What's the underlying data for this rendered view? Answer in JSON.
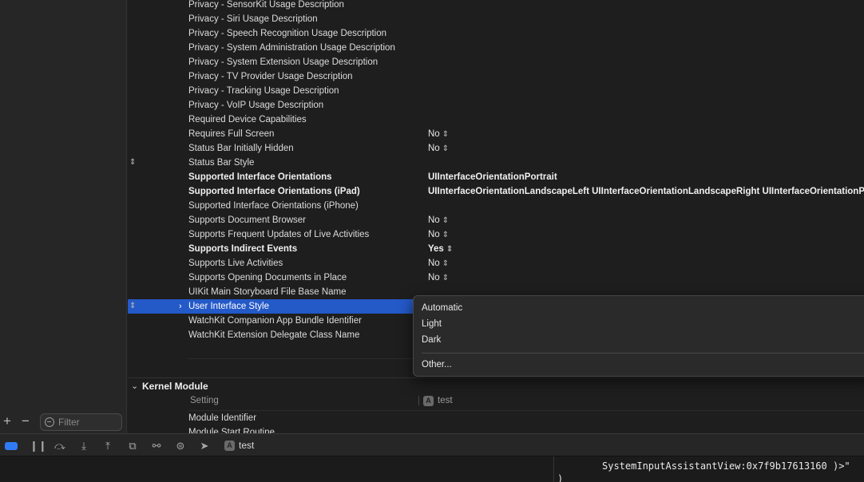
{
  "sidebar": {
    "add_symbol": "+",
    "remove_symbol": "−",
    "filter_placeholder": "Filter"
  },
  "rows": [
    {
      "key": "Privacy - SensorKit Usage Description",
      "value": "",
      "stepper": false
    },
    {
      "key": "Privacy - Siri Usage Description",
      "value": "",
      "stepper": false
    },
    {
      "key": "Privacy - Speech Recognition Usage Description",
      "value": "",
      "stepper": false
    },
    {
      "key": "Privacy - System Administration Usage Description",
      "value": "",
      "stepper": false
    },
    {
      "key": "Privacy - System Extension Usage Description",
      "value": "",
      "stepper": false
    },
    {
      "key": "Privacy - TV Provider Usage Description",
      "value": "",
      "stepper": false
    },
    {
      "key": "Privacy - Tracking Usage Description",
      "value": "",
      "stepper": false
    },
    {
      "key": "Privacy - VoIP Usage Description",
      "value": "",
      "stepper": false
    },
    {
      "key": "Required Device Capabilities",
      "value": "",
      "stepper": false
    },
    {
      "key": "Requires Full Screen",
      "value": "No",
      "stepper": true
    },
    {
      "key": "Status Bar Initially Hidden",
      "value": "No",
      "stepper": true
    },
    {
      "key": "Status Bar Style",
      "value": "",
      "stepper": false,
      "left_stepper": true
    },
    {
      "key": "Supported Interface Orientations",
      "value": "UIInterfaceOrientationPortrait",
      "stepper": false,
      "bold": true
    },
    {
      "key": "Supported Interface Orientations (iPad)",
      "value": "UIInterfaceOrientationLandscapeLeft UIInterfaceOrientationLandscapeRight UIInterfaceOrientationPortrait",
      "stepper": false,
      "bold": true
    },
    {
      "key": "Supported Interface Orientations (iPhone)",
      "value": "",
      "stepper": false
    },
    {
      "key": "Supports Document Browser",
      "value": "No",
      "stepper": true
    },
    {
      "key": "Supports Frequent Updates of Live Activities",
      "value": "No",
      "stepper": true
    },
    {
      "key": "Supports Indirect Events",
      "value": "Yes",
      "stepper": true,
      "bold": true
    },
    {
      "key": "Supports Live Activities",
      "value": "No",
      "stepper": true
    },
    {
      "key": "Supports Opening Documents in Place",
      "value": "No",
      "stepper": true
    },
    {
      "key": "UIKit Main Storyboard File Base Name",
      "value": "",
      "stepper": false
    },
    {
      "key": "User Interface Style",
      "value": "",
      "stepper": false,
      "selected": true
    },
    {
      "key": "WatchKit Companion App Bundle Identifier",
      "value": "",
      "stepper": false
    },
    {
      "key": "WatchKit Extension Delegate Class Name",
      "value": "",
      "stepper": false
    }
  ],
  "stepper_glyph": "⌃⌄",
  "popup_menu": {
    "items": [
      "Automatic",
      "Light",
      "Dark"
    ],
    "other": "Other..."
  },
  "kernel_module": {
    "title": "Kernel Module",
    "setting_label": "Setting",
    "target_label": "test",
    "rows": [
      "Module Identifier",
      "Module Start Routine"
    ]
  },
  "debug_bar": {
    "scheme_name": "test",
    "accent_color": "#2f7bf5"
  },
  "console": {
    "line1": "SystemInputAssistantView:0x7f9b17613160 )>\"",
    "line2": ")"
  },
  "colors": {
    "selection": "#2459c8",
    "background": "#1e1e1e"
  }
}
